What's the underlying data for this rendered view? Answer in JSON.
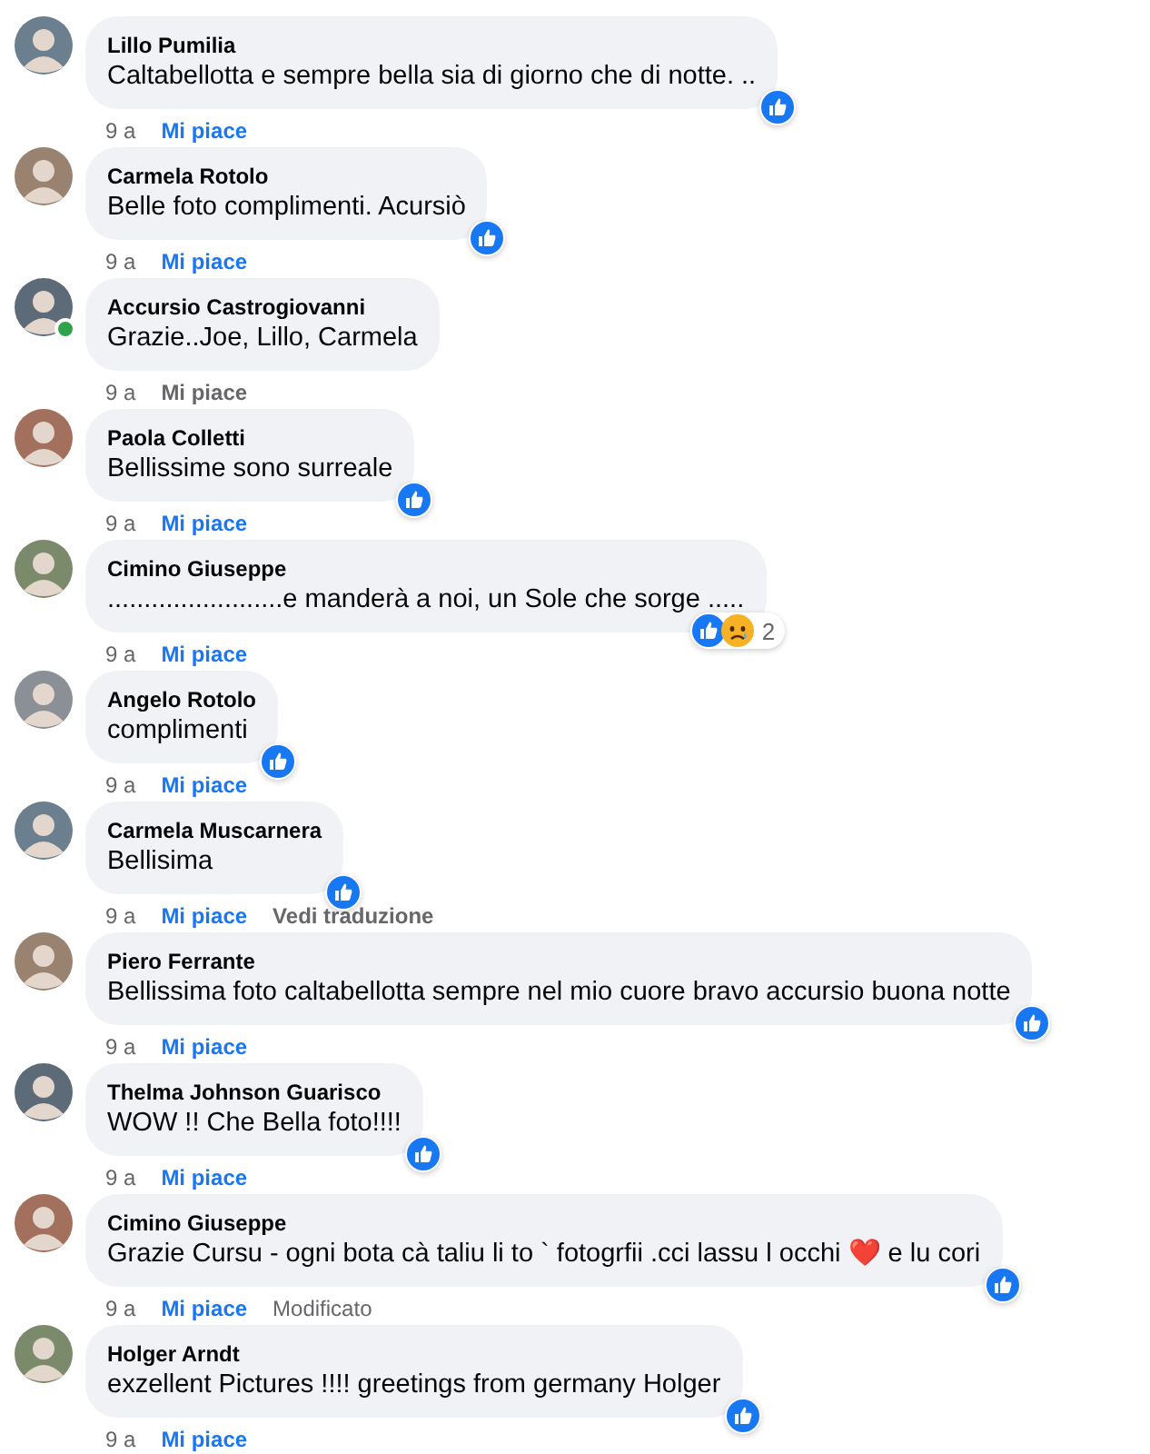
{
  "comments": [
    {
      "author": "Lillo Pumilia",
      "text": "Caltabellotta e sempre bella sia di giorno che di notte. ..",
      "online": false,
      "reactions": [
        {
          "kind": "like"
        }
      ],
      "time": "9 a",
      "like_label": "Mi piace",
      "liked": true
    },
    {
      "author": "Carmela Rotolo",
      "text": "Belle foto complimenti. Acursiò",
      "online": false,
      "reactions": [
        {
          "kind": "like"
        }
      ],
      "time": "9 a",
      "like_label": "Mi piace",
      "liked": true
    },
    {
      "author": "Accursio Castrogiovanni",
      "text": "Grazie..Joe, Lillo, Carmela",
      "online": true,
      "time": "9 a",
      "like_label": "Mi piace",
      "liked": false
    },
    {
      "author": "Paola Colletti",
      "text": "Bellissime sono surreale",
      "online": false,
      "reactions": [
        {
          "kind": "like"
        }
      ],
      "time": "9 a",
      "like_label": "Mi piace",
      "liked": true
    },
    {
      "author": "Cimino Giuseppe",
      "text": "........................e manderà a noi, un Sole che sorge .....",
      "online": false,
      "reactions": [
        {
          "kind": "like"
        },
        {
          "kind": "sad"
        }
      ],
      "reaction_count": "2",
      "time": "9 a",
      "like_label": "Mi piace",
      "liked": true
    },
    {
      "author": "Angelo Rotolo",
      "text": "complimenti",
      "online": false,
      "reactions": [
        {
          "kind": "like"
        }
      ],
      "time": "9 a",
      "like_label": "Mi piace",
      "liked": true
    },
    {
      "author": "Carmela Muscarnera",
      "text": "Bellisima",
      "online": false,
      "reactions": [
        {
          "kind": "like"
        }
      ],
      "time": "9 a",
      "like_label": "Mi piace",
      "liked": true,
      "extra": {
        "kind": "link",
        "text": "Vedi traduzione"
      }
    },
    {
      "author": "Piero Ferrante",
      "text": "Bellissima foto caltabellotta sempre nel mio cuore bravo accursio buona notte",
      "online": false,
      "reactions": [
        {
          "kind": "like"
        }
      ],
      "time": "9 a",
      "like_label": "Mi piace",
      "liked": true
    },
    {
      "author": "Thelma Johnson Guarisco",
      "text": "WOW !! Che Bella foto!!!!",
      "online": false,
      "reactions": [
        {
          "kind": "like"
        }
      ],
      "time": "9 a",
      "like_label": "Mi piace",
      "liked": true
    },
    {
      "author": "Cimino Giuseppe",
      "text": "Grazie Cursu - ogni bota cà taliu li to ` fotogrfii .cci lassu l occhi ❤️ e lu cori",
      "online": false,
      "reactions": [
        {
          "kind": "like"
        }
      ],
      "time": "9 a",
      "like_label": "Mi piace",
      "liked": true,
      "extra": {
        "kind": "note",
        "text": "Modificato"
      }
    },
    {
      "author": "Holger Arndt",
      "text": "exzellent Pictures !!!! greetings from germany Holger",
      "online": false,
      "reactions": [
        {
          "kind": "like"
        }
      ],
      "time": "9 a",
      "like_label": "Mi piace",
      "liked": true
    }
  ]
}
